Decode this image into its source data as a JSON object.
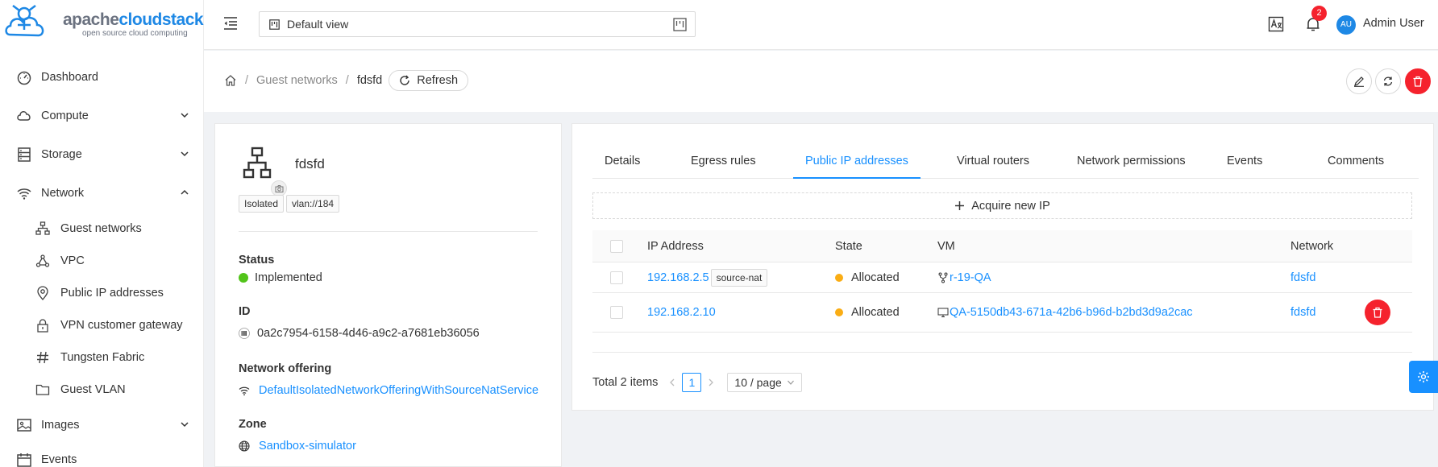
{
  "logo": {
    "brand_a": "apache",
    "brand_b": "cloudstack",
    "tagline": "open source cloud computing"
  },
  "sidebar": {
    "items": [
      {
        "label": "Dashboard",
        "icon": "dashboard-icon"
      },
      {
        "label": "Compute",
        "icon": "cloud-icon",
        "expanded": false
      },
      {
        "label": "Storage",
        "icon": "database-icon",
        "expanded": false
      },
      {
        "label": "Network",
        "icon": "wifi-icon",
        "expanded": true
      },
      {
        "label": "Images",
        "icon": "picture-icon",
        "expanded": false
      },
      {
        "label": "Events",
        "icon": "calendar-icon"
      }
    ],
    "network_sub": [
      {
        "label": "Guest networks",
        "icon": "apartment-icon"
      },
      {
        "label": "VPC",
        "icon": "deployment-unit-icon"
      },
      {
        "label": "Public IP addresses",
        "icon": "environment-icon"
      },
      {
        "label": "VPN customer gateway",
        "icon": "lock-icon"
      },
      {
        "label": "Tungsten Fabric",
        "icon": "number-icon"
      },
      {
        "label": "Guest VLAN",
        "icon": "folder-icon"
      }
    ]
  },
  "header": {
    "view_selector": "Default view",
    "notifications_count": "2",
    "user_initials": "AU",
    "user_name": "Admin User"
  },
  "breadcrumb": {
    "parent": "Guest networks",
    "current": "fdsfd",
    "refresh_label": "Refresh"
  },
  "network": {
    "name": "fdsfd",
    "tags": [
      "Isolated",
      "vlan://184"
    ],
    "status_label": "Status",
    "status": "Implemented",
    "status_color": "#52c41a",
    "id_label": "ID",
    "id": "0a2c7954-6158-4d46-a9c2-a7681eb36056",
    "offering_label": "Network offering",
    "offering": "DefaultIsolatedNetworkOfferingWithSourceNatService",
    "zone_label": "Zone",
    "zone": "Sandbox-simulator"
  },
  "tabs": [
    "Details",
    "Egress rules",
    "Public IP addresses",
    "Virtual routers",
    "Network permissions",
    "Events",
    "Comments"
  ],
  "active_tab": "Public IP addresses",
  "acquire_label": "Acquire new IP",
  "table": {
    "columns": [
      "IP Address",
      "State",
      "VM",
      "Network"
    ],
    "rows": [
      {
        "ip": "192.168.2.5",
        "tag": "source-nat",
        "state": "Allocated",
        "vm": "r-19-QA",
        "vm_icon": "fork-icon",
        "network": "fdsfd",
        "deletable": false
      },
      {
        "ip": "192.168.2.10",
        "tag": "",
        "state": "Allocated",
        "vm": "QA-5150db43-671a-42b6-b96d-b2bd3d9a2cac",
        "vm_icon": "desktop-icon",
        "network": "fdsfd",
        "deletable": true
      }
    ],
    "state_color": "#faad14"
  },
  "pagination": {
    "total": "Total 2 items",
    "page": "1",
    "page_size": "10 / page"
  },
  "colors": {
    "accent": "#1890ff",
    "danger": "#f5222d"
  }
}
